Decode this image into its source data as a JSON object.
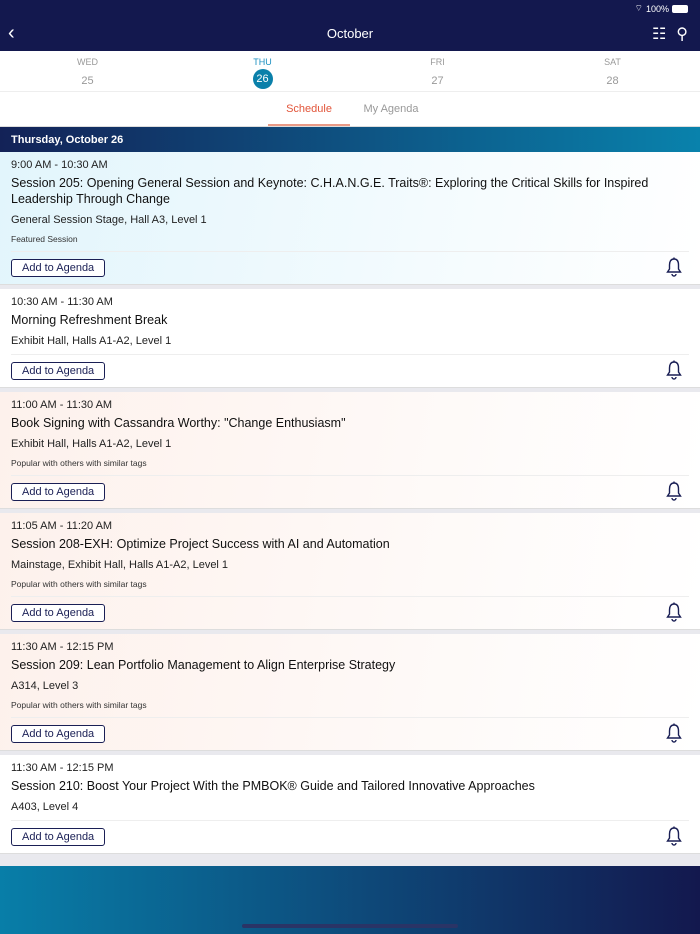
{
  "status": {
    "battery": "100%"
  },
  "header": {
    "title": "October"
  },
  "days": [
    {
      "name": "WED",
      "date": "25"
    },
    {
      "name": "THU",
      "date": "26"
    },
    {
      "name": "FRI",
      "date": "27"
    },
    {
      "name": "SAT",
      "date": "28"
    }
  ],
  "tabs": [
    "Schedule",
    "My Agenda"
  ],
  "day_heading": "Thursday, October 26",
  "add_label": "Add to Agenda",
  "sessions": [
    {
      "time": "9:00 AM - 10:30 AM",
      "title": "Session 205: Opening General Session and Keynote: C.H.A.N.G.E. Traits®: Exploring the Critical Skills for Inspired Leadership Through Change",
      "location": "General Session Stage, Hall A3, Level 1",
      "note": "Featured Session"
    },
    {
      "time": "10:30 AM - 11:30 AM",
      "title": "Morning Refreshment Break",
      "location": "Exhibit Hall, Halls A1-A2, Level 1"
    },
    {
      "time": "11:00 AM - 11:30 AM",
      "title": "Book Signing with Cassandra Worthy: \"Change Enthusiasm\"",
      "location": "Exhibit Hall, Halls A1-A2, Level 1",
      "note": "Popular with others with similar tags"
    },
    {
      "time": "11:05 AM - 11:20 AM",
      "title": "Session 208-EXH: Optimize Project Success with AI and Automation",
      "location": "Mainstage, Exhibit Hall, Halls A1-A2, Level 1",
      "note": "Popular with others with similar tags"
    },
    {
      "time": "11:30 AM - 12:15 PM",
      "title": "Session 209: Lean Portfolio Management to Align Enterprise Strategy",
      "location": "A314, Level 3",
      "note": "Popular with others with similar tags"
    },
    {
      "time": "11:30 AM - 12:15 PM",
      "title": "Session 210: Boost Your Project With the PMBOK® Guide and Tailored Innovative Approaches",
      "location": "A403, Level 4"
    }
  ]
}
